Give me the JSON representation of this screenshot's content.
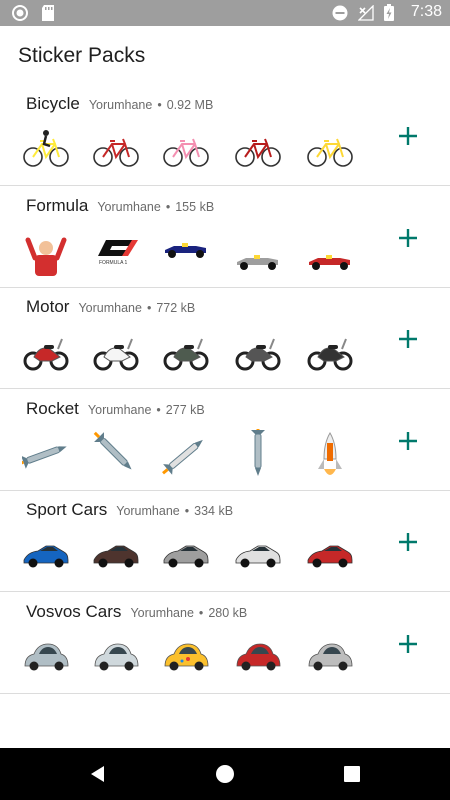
{
  "status": {
    "time": "7:38"
  },
  "app": {
    "title": "Sticker Packs"
  },
  "accent_color": "#00796b",
  "packs": [
    {
      "name": "Bicycle",
      "publisher": "Yorumhane",
      "size": "0.92 MB",
      "icons": [
        "bicycle-racer-sticker",
        "bicycle-red-sticker",
        "bicycle-pink-sticker",
        "bicycle-city-sticker",
        "bicycle-yellow-sticker"
      ]
    },
    {
      "name": "Formula",
      "publisher": "Yorumhane",
      "size": "155 kB",
      "icons": [
        "driver-celebrating-sticker",
        "f1-logo-sticker",
        "formula-car-sticker",
        "formula-car-sticker",
        "formula-car-sticker"
      ]
    },
    {
      "name": "Motor",
      "publisher": "Yorumhane",
      "size": "772 kB",
      "icons": [
        "motorcycle-sticker",
        "scooter-sticker",
        "scooter-sticker",
        "motorcycle-sticker",
        "motorcycle-sticker"
      ]
    },
    {
      "name": "Rocket",
      "publisher": "Yorumhane",
      "size": "277 kB",
      "icons": [
        "rocket-sticker",
        "rocket-sticker",
        "rocket-sticker",
        "rocket-sticker",
        "space-shuttle-sticker"
      ]
    },
    {
      "name": "Sport Cars",
      "publisher": "Yorumhane",
      "size": "334 kB",
      "icons": [
        "sports-car-blue-sticker",
        "sports-car-black-sticker",
        "sports-car-silver-sticker",
        "sports-car-white-sticker",
        "sports-car-red-sticker"
      ]
    },
    {
      "name": "Vosvos Cars",
      "publisher": "Yorumhane",
      "size": "280 kB",
      "icons": [
        "beetle-grey-sticker",
        "beetle-convertible-sticker",
        "beetle-yellow-sticker",
        "beetle-red-sticker",
        "beetle-silver-sticker"
      ]
    }
  ],
  "meta_separator": "•"
}
